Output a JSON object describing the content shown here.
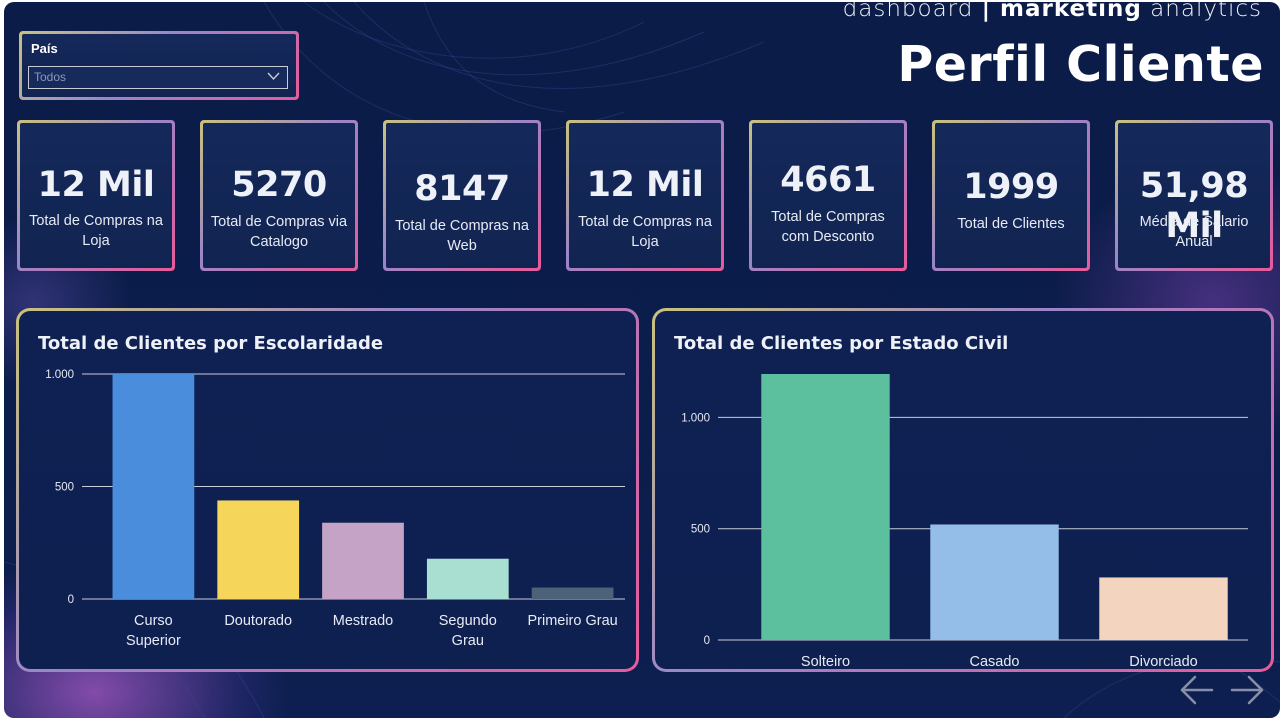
{
  "brand": {
    "light1": "dashboard ",
    "sep": "| ",
    "bold": "marketing",
    "light2": " analytics"
  },
  "page_title": "Perfil Cliente",
  "filter": {
    "label": "País",
    "value": "Todos"
  },
  "kpis": [
    {
      "value": "12 Mil",
      "label": "Total de Compras na Loja"
    },
    {
      "value": "5270",
      "label": "Total de Compras via Catalogo"
    },
    {
      "value": "8147",
      "label": "Total de Compras na Web"
    },
    {
      "value": "12 Mil",
      "label": "Total de Compras na Loja"
    },
    {
      "value": "4661",
      "label": "Total de Compras com Desconto"
    },
    {
      "value": "1999",
      "label": "Total de Clientes"
    },
    {
      "value": "51,98 Mil",
      "label": "Média de Salario Anual"
    }
  ],
  "colors": {
    "frame_gradient": [
      "#c9c27e",
      "#9a86c8",
      "#e85a9a"
    ],
    "background": "#0b1c49"
  },
  "icons": [
    "chevron-down-icon",
    "arrow-left-icon",
    "arrow-right-icon"
  ],
  "chart_data": [
    {
      "type": "bar",
      "title": "Total de Clientes por Escolaridade",
      "categories": [
        "Curso Superior",
        "Doutorado",
        "Mestrado",
        "Segundo Grau",
        "Primeiro Grau"
      ],
      "category_lines": [
        [
          "Curso",
          "Superior"
        ],
        [
          "Doutorado"
        ],
        [
          "Mestrado"
        ],
        [
          "Segundo",
          "Grau"
        ],
        [
          "Primeiro Grau"
        ]
      ],
      "values": [
        1000,
        438,
        339,
        179,
        51
      ],
      "bar_colors": [
        "#4a8ddc",
        "#f5d55a",
        "#c4a3c7",
        "#a8dfd0",
        "#4d6278"
      ],
      "yticks": [
        0,
        500,
        1000
      ],
      "ytick_labels": [
        "0",
        "500",
        "1.000"
      ],
      "ylim": [
        0,
        1000
      ],
      "grid": true
    },
    {
      "type": "bar",
      "title": "Total de Clientes por Estado Civil",
      "categories": [
        "Solteiro",
        "Casado",
        "Divorciado"
      ],
      "category_lines": [
        [
          "Solteiro"
        ],
        [
          "Casado"
        ],
        [
          "Divorciado"
        ]
      ],
      "values": [
        1195,
        519,
        281
      ],
      "bar_colors": [
        "#5cc09e",
        "#94bde8",
        "#f2d4bf"
      ],
      "yticks": [
        0,
        500,
        1000
      ],
      "ytick_labels": [
        "0",
        "500",
        "1.000"
      ],
      "ylim": [
        0,
        1195
      ],
      "grid": true
    }
  ]
}
